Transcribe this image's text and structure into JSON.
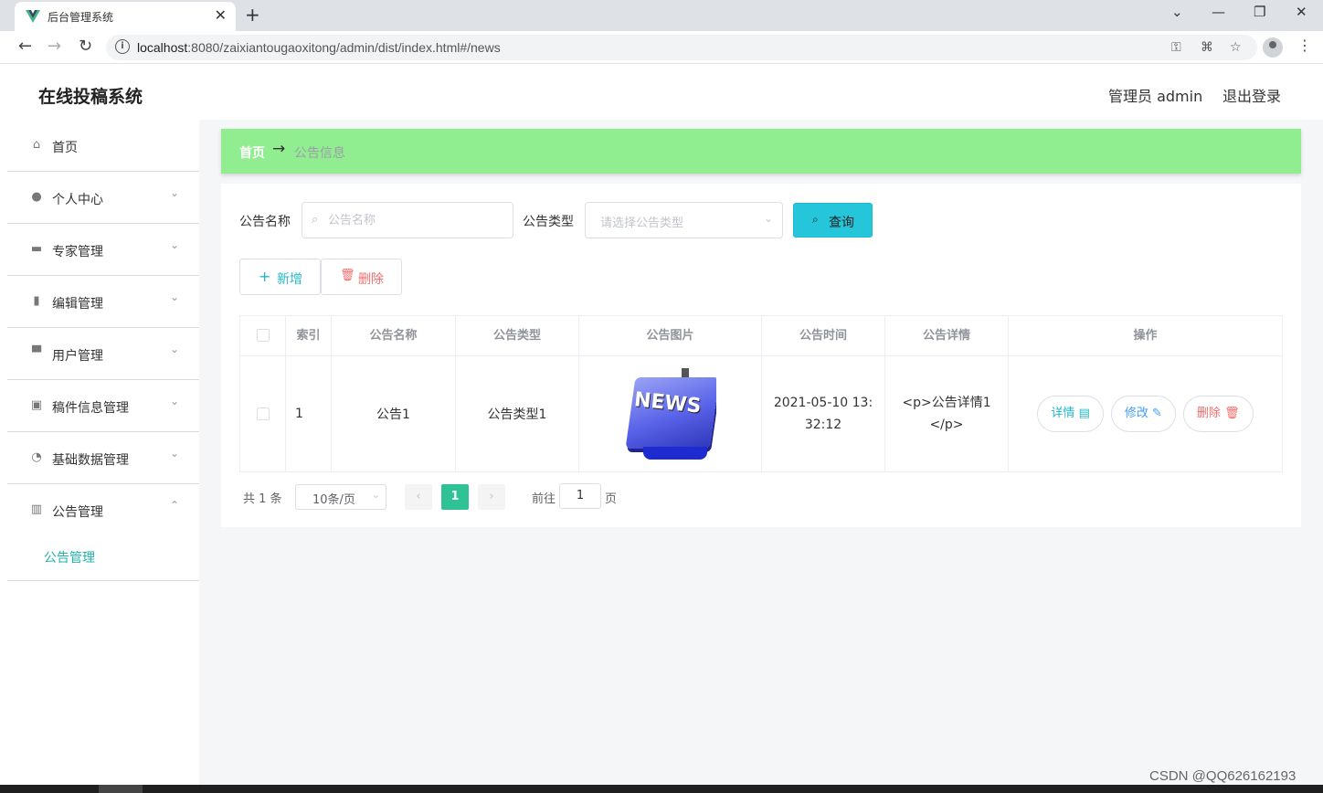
{
  "browser": {
    "tab_title": "后台管理系统",
    "url_host": "localhost",
    "url_rest": ":8080/zaixiantougaoxitong/admin/dist/index.html#/news"
  },
  "header": {
    "app_title": "在线投稿系统",
    "admin_label": "管理员 admin",
    "logout_label": "退出登录"
  },
  "sidebar": {
    "items": [
      {
        "label": "首页",
        "icon": "home-icon"
      },
      {
        "label": "个人中心",
        "icon": "user-icon"
      },
      {
        "label": "专家管理",
        "icon": "briefcase-icon"
      },
      {
        "label": "编辑管理",
        "icon": "books-icon"
      },
      {
        "label": "用户管理",
        "icon": "printer-icon"
      },
      {
        "label": "稿件信息管理",
        "icon": "clipboard-icon"
      },
      {
        "label": "基础数据管理",
        "icon": "gauge-icon"
      },
      {
        "label": "公告管理",
        "icon": "chart-icon"
      }
    ],
    "sub_item": "公告管理"
  },
  "breadcrumb": {
    "home": "首页",
    "arrow": "→",
    "current": "公告信息"
  },
  "filters": {
    "name_label": "公告名称",
    "name_placeholder": "公告名称",
    "type_label": "公告类型",
    "type_placeholder": "请选择公告类型",
    "query_label": "查询"
  },
  "actions": {
    "add_label": "新增",
    "delete_label": "删除"
  },
  "table": {
    "columns": [
      "索引",
      "公告名称",
      "公告类型",
      "公告图片",
      "公告时间",
      "公告详情",
      "操作"
    ],
    "rows": [
      {
        "index": "1",
        "name": "公告1",
        "type": "公告类型1",
        "image_text": "NEWS",
        "time": "2021-05-10 13:32:12",
        "detail": "<p>公告详情1</p>",
        "op_detail": "详情",
        "op_edit": "修改",
        "op_delete": "删除"
      }
    ]
  },
  "pagination": {
    "total": "共 1 条",
    "page_size": "10条/页",
    "current": "1",
    "goto_label": "前往",
    "goto_value": "1",
    "page_label": "页"
  },
  "watermark": "CSDN @QQ626162193",
  "colors": {
    "breadcrumb_bg": "#90ee90",
    "accent": "#26c6da",
    "active_page": "#2ec295",
    "danger": "#f56c6c"
  }
}
